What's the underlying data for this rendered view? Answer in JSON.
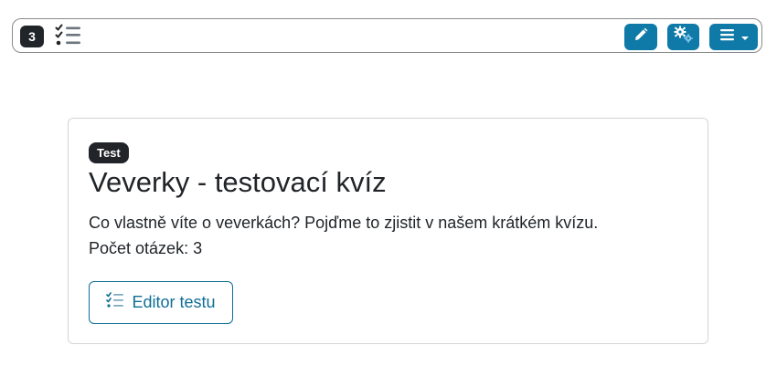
{
  "toolbar": {
    "question_count": "3",
    "icons": {
      "quiz": "checklist-icon",
      "edit": "pencil-icon",
      "settings": "gears-icon",
      "menu": "hamburger-menu-icon",
      "menu_caret": "caret-down-icon"
    },
    "accent_color": "#0f7aa8"
  },
  "card": {
    "type_badge": "Test",
    "title": "Veverky - testovací kvíz",
    "description": "Co vlastně víte o veverkách? Pojďme to zjistit v našem krátkém kvízu.",
    "question_count_text": "Počet otázek: 3",
    "editor_button": {
      "label": "Editor testu",
      "icon": "checklist-icon"
    }
  }
}
